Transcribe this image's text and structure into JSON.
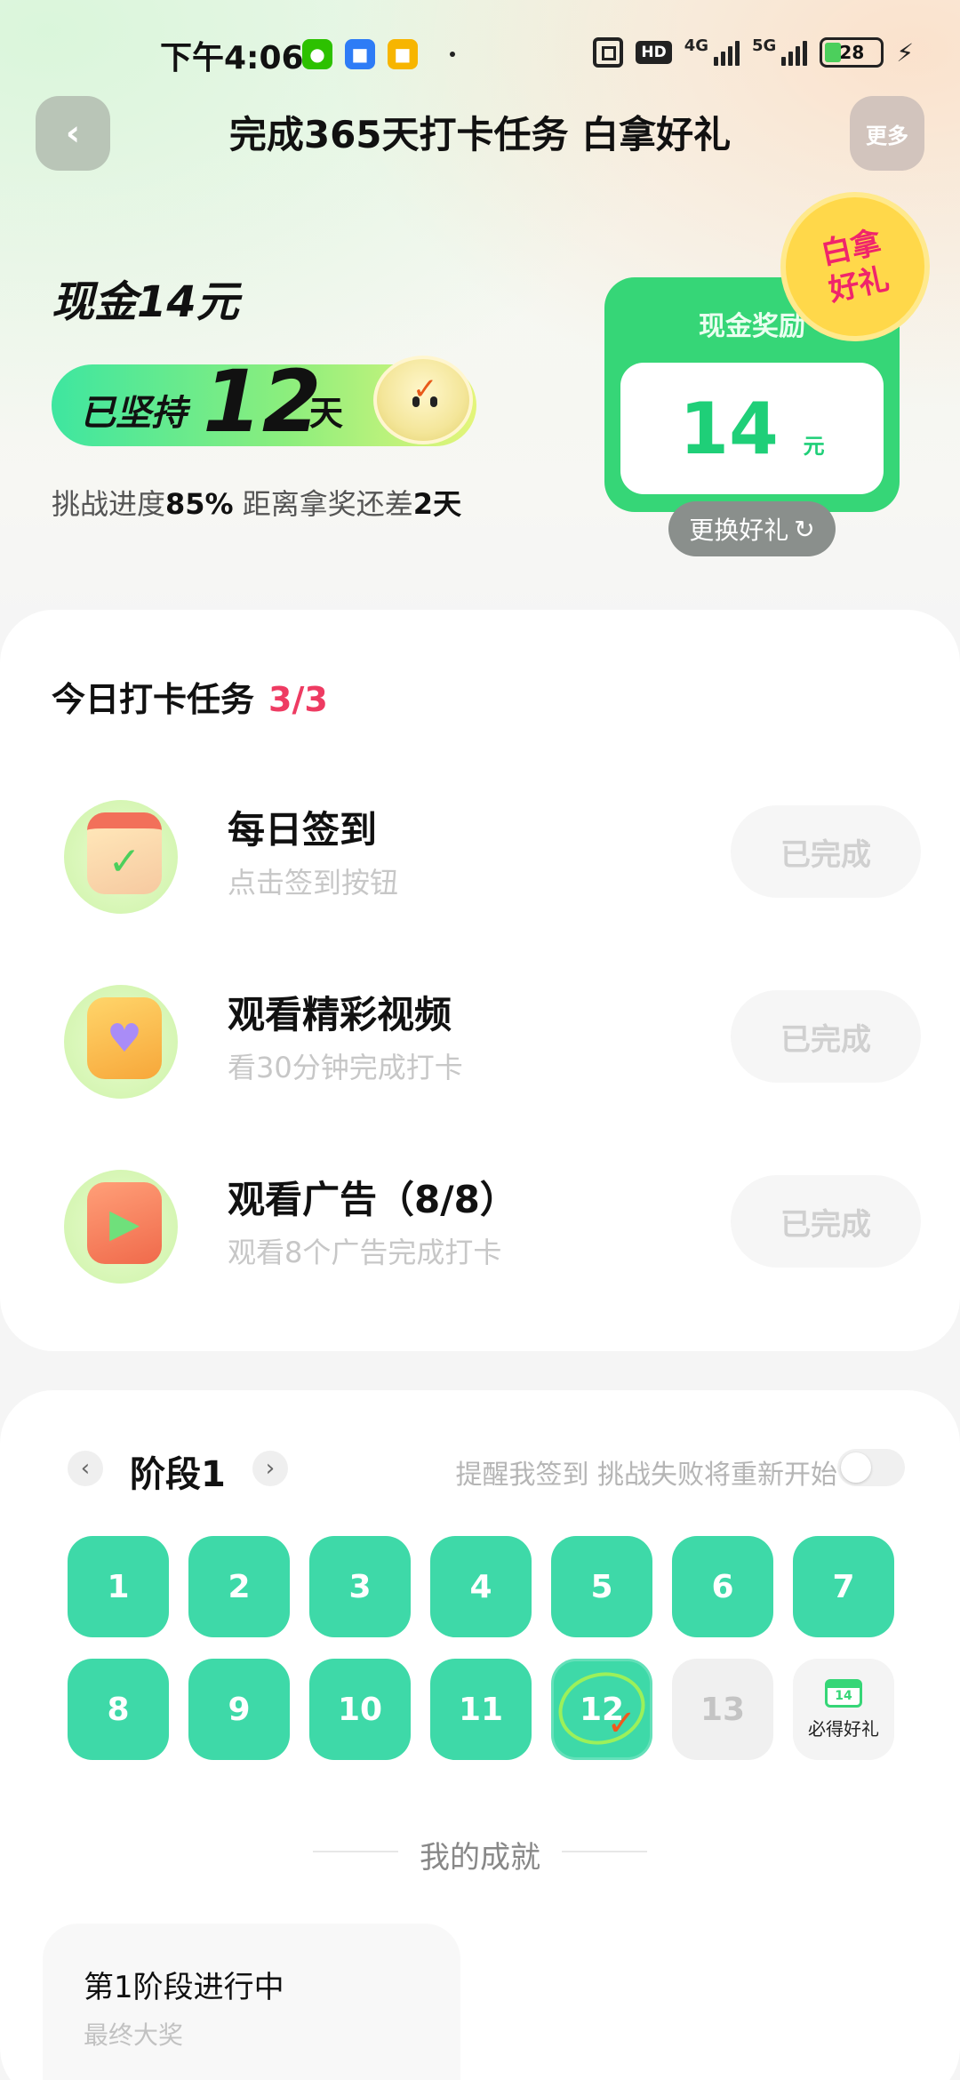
{
  "status_bar": {
    "time": "下午4:06",
    "hd": "HD",
    "net1": "4G",
    "net2": "5G",
    "battery": "28",
    "app_icons": [
      "wechat-icon",
      "app-blue-icon",
      "app-yellow-icon"
    ]
  },
  "header": {
    "title": "完成365天打卡任务 白拿好礼",
    "more": "更多"
  },
  "hero": {
    "cash_title": "现金14元",
    "streak_prefix": "已坚持",
    "streak_days": "12",
    "streak_unit": "天",
    "progress_prefix": "挑战进度",
    "progress_percent": "85%",
    "progress_mid": " 距离拿奖还差",
    "days_left": "2天"
  },
  "reward": {
    "label": "现金奖励",
    "value": "14",
    "unit": "元",
    "badge_line1": "白拿",
    "badge_line2": "好礼",
    "swap": "更换好礼"
  },
  "tasks": {
    "header": "今日打卡任务",
    "count": "3/3",
    "items": [
      {
        "title": "每日签到",
        "sub": "点击签到按钮",
        "status": "已完成"
      },
      {
        "title": "观看精彩视频",
        "sub": "看30分钟完成打卡",
        "status": "已完成"
      },
      {
        "title": "观看广告（8/8）",
        "sub": "观看8个广告完成打卡",
        "status": "已完成"
      }
    ]
  },
  "stage": {
    "name": "阶段1",
    "remind": "提醒我签到 挑战失败将重新开始",
    "days": [
      "1",
      "2",
      "3",
      "4",
      "5",
      "6",
      "7",
      "8",
      "9",
      "10",
      "11",
      "12",
      "13"
    ],
    "gift_date": "14",
    "gift_label": "必得好礼"
  },
  "achievement": {
    "title": "我的成就",
    "card_name": "第1阶段进行中",
    "card_sub": "最终大奖"
  },
  "colors": {
    "accent_green": "#36d677",
    "day_teal": "#3ed9a8",
    "count_red": "#ee3b62"
  }
}
